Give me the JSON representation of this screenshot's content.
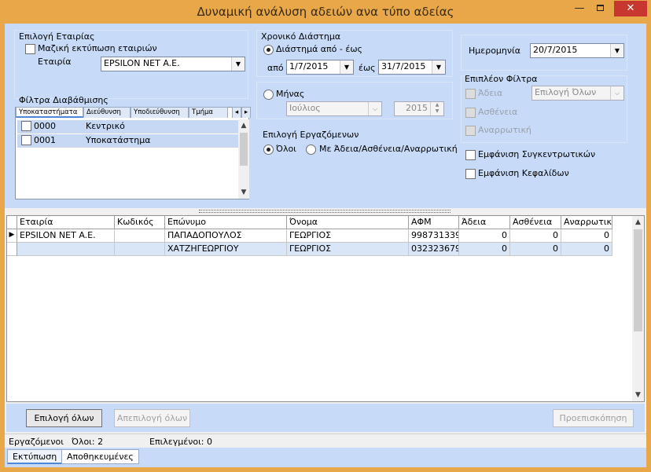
{
  "window": {
    "title": "Δυναμική ανάλυση αδειών ανα τύπο αδείας",
    "minimize": "—",
    "close": "✕"
  },
  "company": {
    "group_label": "Επιλογή Εταιρίας",
    "bulk_print_label": "Μαζική εκτύπωση εταιριών",
    "bulk_print_checked": false,
    "company_label": "Εταιρία",
    "company_value": "EPSILON NET A.E."
  },
  "time_range": {
    "group_label": "Χρονικό Διάστημα",
    "range_label": "Διάστημά από - έως",
    "range_selected": true,
    "from_label": "από",
    "from_value": "1/7/2015",
    "to_label": "έως",
    "to_value": "31/7/2015",
    "month_label": "Μήνας",
    "month_value": "Ιούλιος",
    "year_value": "2015"
  },
  "date": {
    "label": "Ημερομηνία",
    "value": "20/7/2015"
  },
  "extra_filters": {
    "group_label": "Επιπλέον Φίλτρα",
    "leave_label": "Άδεια",
    "leave_select": "Επιλογή Όλων",
    "sick_label": "Ασθένεια",
    "disability_label": "Αναρρωτική"
  },
  "grading_filters": {
    "group_label": "Φίλτρα Διαβάθμισης",
    "tabs": [
      "Υποκαταστήματα",
      "Διεύθυνση",
      "Υποδιεύθυνση",
      "Τμήμα"
    ],
    "rows": [
      {
        "code": "0000",
        "name": "Κεντρικό"
      },
      {
        "code": "0001",
        "name": "Υποκατάστημα"
      }
    ]
  },
  "employees": {
    "group_label": "Επιλογή Εργαζόμενων",
    "all_label": "Όλοι",
    "with_leave_label": "Με Άδεια/Ασθένεια/Αναρρωτική"
  },
  "display": {
    "totals_label": "Εμφάνιση Συγκεντρωτικών",
    "headers_label": "Εμφάνιση Κεφαλίδων"
  },
  "grid": {
    "columns": [
      "Εταιρία",
      "Κωδικός",
      "Επώνυμο",
      "Όνομα",
      "ΑΦΜ",
      "Άδεια",
      "Ασθένεια",
      "Αναρρωτική"
    ],
    "rows": [
      {
        "company": "EPSILON NET A.E.",
        "code": "",
        "surname": "ΠΑΠΑΔΟΠΟΥΛΟΣ",
        "name": "ΓΕΩΡΓΙΟΣ",
        "afm": "998731339",
        "leave": "0",
        "sick": "0",
        "disability": "0"
      },
      {
        "company": "",
        "code": "",
        "surname": "ΧΑΤΖΗΓΕΩΡΓΙΟΥ",
        "name": "ΓΕΩΡΓΙΟΣ",
        "afm": "032323679",
        "leave": "0",
        "sick": "0",
        "disability": "0"
      }
    ]
  },
  "buttons": {
    "select_all": "Επιλογή όλων",
    "deselect_all": "Απεπιλογή όλων",
    "preview": "Προεπισκόπηση"
  },
  "status": {
    "employees_label": "Εργαζόμενοι",
    "all_count": "Όλοι: 2",
    "selected_count": "Επιλεγμένοι: 0"
  },
  "bottom_tabs": [
    "Εκτύπωση",
    "Αποθηκευμένες"
  ]
}
